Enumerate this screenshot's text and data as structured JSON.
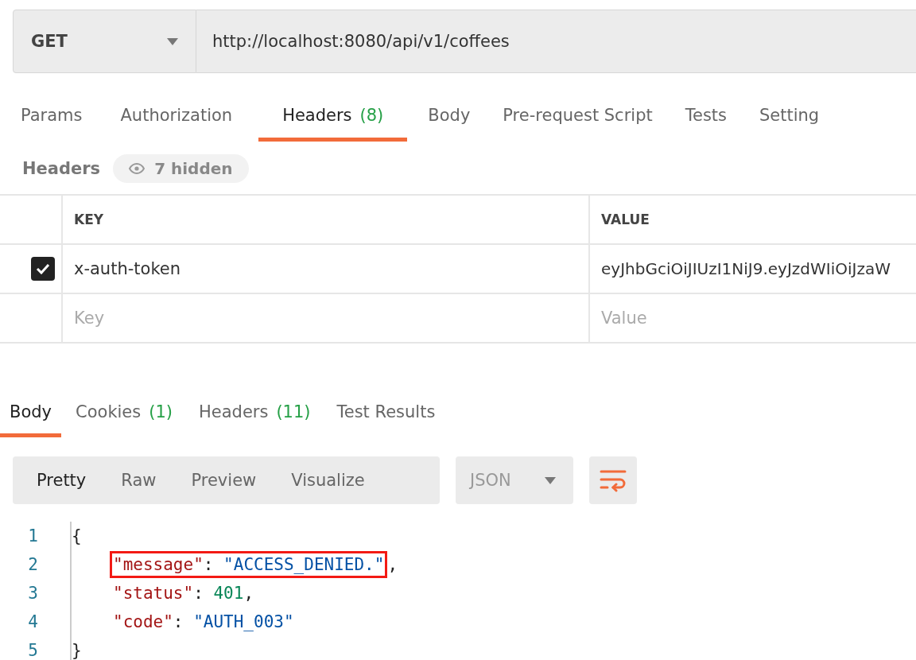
{
  "request": {
    "method": "GET",
    "url": "http://localhost:8080/api/v1/coffees"
  },
  "request_tabs": [
    {
      "label": "Params",
      "selected": false
    },
    {
      "label": "Authorization",
      "selected": false
    },
    {
      "label": "Headers",
      "count": "(8)",
      "selected": true
    },
    {
      "label": "Body",
      "selected": false
    },
    {
      "label": "Pre-request Script",
      "selected": false
    },
    {
      "label": "Tests",
      "selected": false
    },
    {
      "label": "Setting",
      "selected": false
    }
  ],
  "headers_bar": {
    "title": "Headers",
    "hidden_toggle": "7 hidden"
  },
  "headers_table": {
    "columns": [
      "KEY",
      "VALUE"
    ],
    "rows": [
      {
        "checked": true,
        "key": "x-auth-token",
        "value": "eyJhbGciOiJIUzI1NiJ9.eyJzdWIiOiJzaW"
      }
    ],
    "new_row": {
      "key_placeholder": "Key",
      "value_placeholder": "Value"
    }
  },
  "response_tabs": [
    {
      "label": "Body",
      "selected": true
    },
    {
      "label": "Cookies",
      "count": "(1)",
      "selected": false
    },
    {
      "label": "Headers",
      "count": "(11)",
      "selected": false
    },
    {
      "label": "Test Results",
      "selected": false
    }
  ],
  "view_modes": [
    {
      "label": "Pretty",
      "selected": true
    },
    {
      "label": "Raw",
      "selected": false
    },
    {
      "label": "Preview",
      "selected": false
    },
    {
      "label": "Visualize",
      "selected": false
    }
  ],
  "format": "JSON",
  "code_lines": [
    {
      "number": "1",
      "tokens": [
        {
          "kind": "punct",
          "text": "{"
        }
      ]
    },
    {
      "number": "2",
      "tokens": [
        {
          "kind": "box",
          "tokens": [
            {
              "kind": "key",
              "text": "\"message\""
            },
            {
              "kind": "punct",
              "text": ": "
            },
            {
              "kind": "string",
              "text": "\"ACCESS_DENIED.\""
            }
          ]
        },
        {
          "kind": "punct",
          "text": ","
        }
      ]
    },
    {
      "number": "3",
      "tokens": [
        {
          "kind": "key",
          "text": "\"status\""
        },
        {
          "kind": "punct",
          "text": ": "
        },
        {
          "kind": "number",
          "text": "401"
        },
        {
          "kind": "punct",
          "text": ","
        }
      ]
    },
    {
      "number": "4",
      "tokens": [
        {
          "kind": "key",
          "text": "\"code\""
        },
        {
          "kind": "punct",
          "text": ": "
        },
        {
          "kind": "string",
          "text": "\"AUTH_003\""
        }
      ]
    },
    {
      "number": "5",
      "tokens": [
        {
          "kind": "punct",
          "text": "}"
        }
      ]
    }
  ]
}
